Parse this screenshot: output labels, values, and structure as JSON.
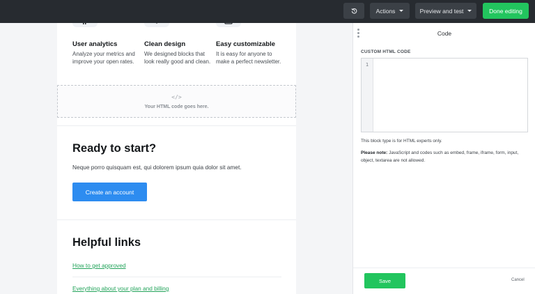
{
  "toolbar": {
    "history_icon": "history-icon",
    "actions_label": "Actions",
    "preview_label": "Preview and test",
    "done_label": "Done editing",
    "colors": {
      "bar": "#272b30",
      "button": "#3b4046",
      "done": "#22c55e"
    }
  },
  "canvas": {
    "features": [
      {
        "title": "User analytics",
        "text": "Analyze your metrics and improve your open rates.",
        "icon": "analytics-icon"
      },
      {
        "title": "Clean design",
        "text": "We designed blocks that look really good and clean.",
        "icon": "design-icon"
      },
      {
        "title": "Easy customizable",
        "text": "It is easy for anyone to make a perfect newsletter.",
        "icon": "customize-icon"
      }
    ],
    "html_block": {
      "icon": "code-icon",
      "label": "Your HTML code goes here."
    },
    "cta": {
      "title": "Ready to start?",
      "text": "Neque porro quisquam est, qui dolorem ipsum quia dolor sit amet.",
      "button": "Create an account",
      "button_color": "#2d8cf0"
    },
    "links": {
      "title": "Helpful links",
      "items": [
        "How to get approved",
        "Everything about your plan and billing"
      ],
      "link_color": "#22a35a"
    }
  },
  "panel": {
    "title": "Code",
    "section_label": "CUSTOM HTML CODE",
    "line_number": "1",
    "code_value": "",
    "note": "This block type is for HTML experts only.",
    "warning_label": "Please note:",
    "warning_text": " JavaScript and codes such as embed, frame, iframe, form, input, object, textarea are not allowed.",
    "save_label": "Save",
    "cancel_label": "Cancel"
  }
}
